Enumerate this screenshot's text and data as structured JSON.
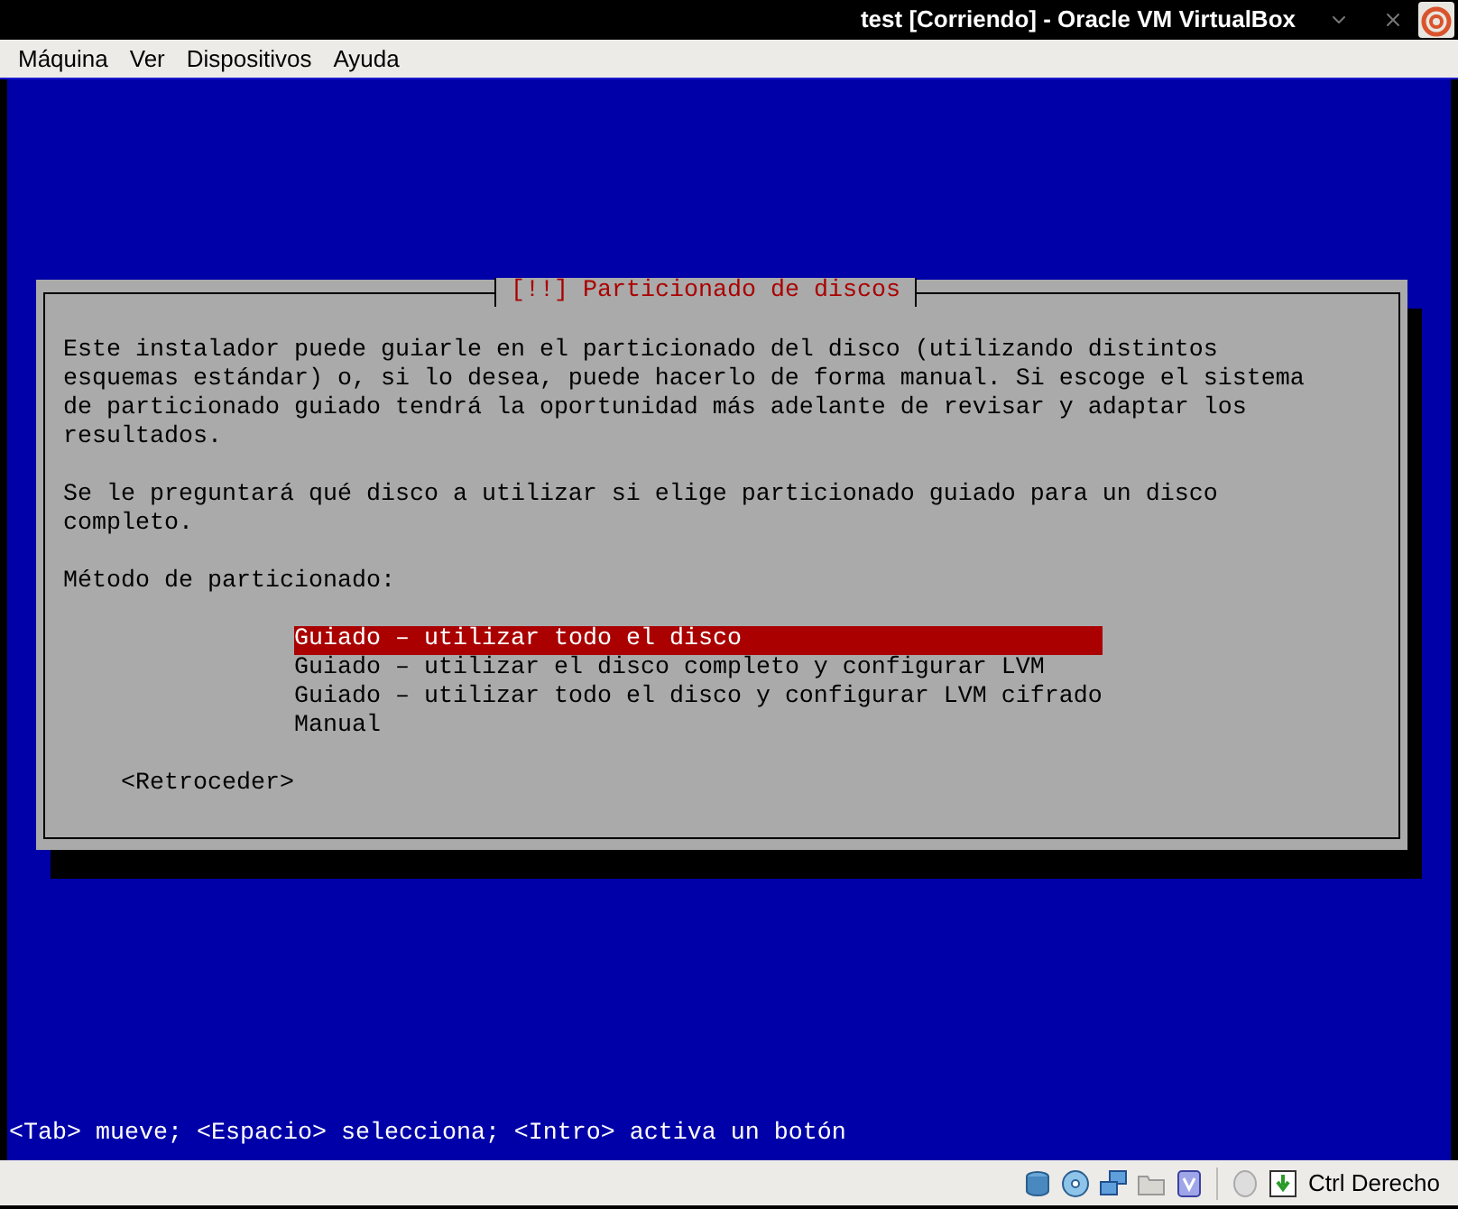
{
  "window": {
    "title": "test [Corriendo] - Oracle VM VirtualBox"
  },
  "menu": [
    "Máquina",
    "Ver",
    "Dispositivos",
    "Ayuda"
  ],
  "dialog": {
    "title": "[!!] Particionado de discos",
    "paragraphs": [
      "Este instalador puede guiarle en el particionado del disco (utilizando distintos esquemas estándar) o, si lo desea, puede hacerlo de forma manual. Si escoge el sistema de particionado guiado tendrá la oportunidad más adelante de revisar y adaptar los resultados.",
      "Se le preguntará qué disco a utilizar si elige particionado guiado para un disco completo."
    ],
    "prompt": "Método de particionado:",
    "options": [
      {
        "label": "Guiado – utilizar todo el disco",
        "selected": true
      },
      {
        "label": "Guiado – utilizar el disco completo y configurar LVM",
        "selected": false
      },
      {
        "label": "Guiado – utilizar todo el disco y configurar LVM cifrado",
        "selected": false
      },
      {
        "label": "Manual",
        "selected": false
      }
    ],
    "back_button": "<Retroceder>"
  },
  "hint": "<Tab> mueve; <Espacio> selecciona; <Intro> activa un botón",
  "status_bar": {
    "host_key": "Ctrl Derecho"
  }
}
